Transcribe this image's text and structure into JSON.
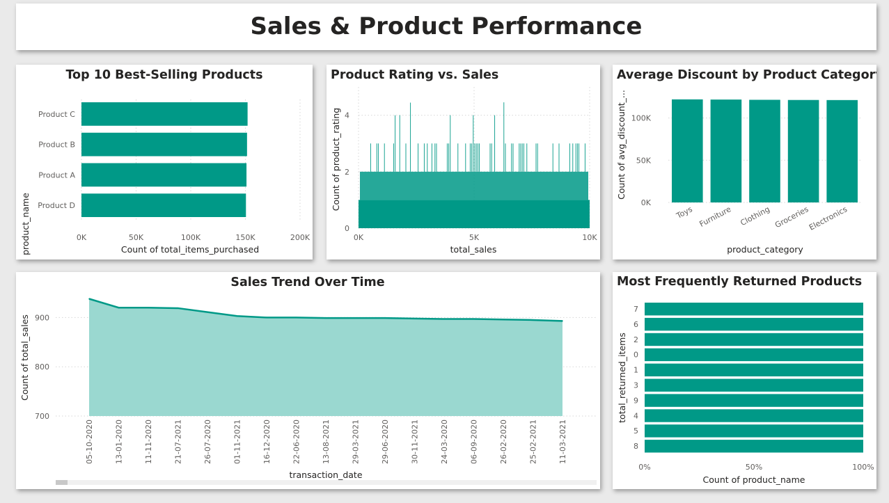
{
  "dashboard": {
    "title": "Sales & Product Performance"
  },
  "colors": {
    "teal": "#009987",
    "area_fill": "#9ad8d0",
    "background": "#eaeaea",
    "card": "#ffffff"
  },
  "chart_data": [
    {
      "id": "top_products",
      "type": "bar",
      "orientation": "horizontal",
      "title": "Top 10 Best-Selling Products",
      "xlabel": "Count of total_items_purchased",
      "ylabel": "product_name",
      "categories": [
        "Product C",
        "Product B",
        "Product A",
        "Product D"
      ],
      "values": [
        152000,
        151500,
        151000,
        150500
      ],
      "xlim": [
        0,
        200000
      ],
      "xticks": [
        "0K",
        "50K",
        "100K",
        "150K",
        "200K"
      ],
      "grid": true
    },
    {
      "id": "rating_vs_sales",
      "type": "bar",
      "title": "Product Rating vs. Sales",
      "xlabel": "total_sales",
      "ylabel": "Count of product_rating",
      "xlim": [
        0,
        10000
      ],
      "ylim": [
        0,
        5
      ],
      "xticks": [
        "0K",
        "5K",
        "10K"
      ],
      "yticks": [
        "0",
        "2",
        "4"
      ],
      "baseline_value": 2,
      "grid": true
    },
    {
      "id": "avg_discount",
      "type": "bar",
      "title": "Average Discount by Product Category",
      "xlabel": "product_category",
      "ylabel": "Count of avg_discount_...",
      "categories": [
        "Toys",
        "Furniture",
        "Clothing",
        "Groceries",
        "Electronics"
      ],
      "values": [
        122000,
        121800,
        121500,
        121300,
        121200
      ],
      "ylim": [
        0,
        140000
      ],
      "yticks": [
        "0K",
        "50K",
        "100K"
      ],
      "grid": true
    },
    {
      "id": "sales_trend",
      "type": "area",
      "title": "Sales Trend Over Time",
      "xlabel": "transaction_date",
      "ylabel": "Count of total_sales",
      "x": [
        "05-10-2020",
        "13-01-2020",
        "11-11-2020",
        "21-07-2021",
        "26-07-2020",
        "01-11-2021",
        "16-12-2020",
        "22-06-2020",
        "13-08-2021",
        "29-03-2021",
        "29-06-2020",
        "30-11-2021",
        "24-03-2020",
        "06-09-2020",
        "26-02-2020",
        "25-02-2021",
        "11-03-2021"
      ],
      "values": [
        938,
        920,
        920,
        919,
        911,
        903,
        900,
        900,
        899,
        899,
        899,
        898,
        897,
        897,
        896,
        895,
        893
      ],
      "ylim": [
        700,
        950
      ],
      "yticks": [
        "700",
        "800",
        "900"
      ],
      "grid": true
    },
    {
      "id": "returned_products",
      "type": "bar",
      "orientation": "horizontal",
      "stacked_percent": true,
      "title": "Most Frequently Returned Products",
      "xlabel": "Count of product_name",
      "ylabel": "total_returned_items",
      "categories": [
        "7",
        "6",
        "2",
        "0",
        "1",
        "3",
        "9",
        "4",
        "5",
        "8"
      ],
      "values": [
        100,
        100,
        100,
        100,
        100,
        100,
        100,
        100,
        100,
        100
      ],
      "xlim": [
        0,
        100
      ],
      "xticks": [
        "0%",
        "50%",
        "100%"
      ]
    }
  ]
}
